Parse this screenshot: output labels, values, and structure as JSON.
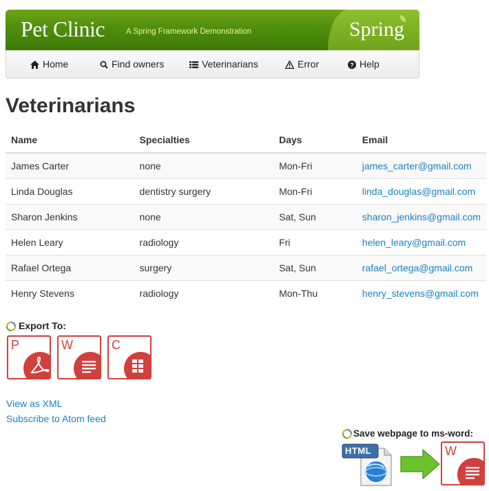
{
  "header": {
    "title": "Pet Clinic",
    "subtitle": "A Spring Framework Demonstration",
    "brand": "Spring"
  },
  "nav": [
    {
      "label": "Home",
      "icon": "home-icon"
    },
    {
      "label": "Find owners",
      "icon": "search-icon"
    },
    {
      "label": "Veterinarians",
      "icon": "list-icon"
    },
    {
      "label": "Error",
      "icon": "warning-icon"
    },
    {
      "label": "Help",
      "icon": "help-icon"
    }
  ],
  "page": {
    "title": "Veterinarians"
  },
  "table": {
    "headers": [
      "Name",
      "Specialties",
      "Days",
      "Email"
    ],
    "rows": [
      [
        "James Carter",
        "none",
        "Mon-Fri",
        "james_carter@gmail.com"
      ],
      [
        "Linda Douglas",
        "dentistry surgery",
        "Mon-Fri",
        "linda_douglas@gmail.com"
      ],
      [
        "Sharon Jenkins",
        "none",
        "Sat, Sun",
        "sharon_jenkins@gmail.com"
      ],
      [
        "Helen Leary",
        "radiology",
        "Fri",
        "helen_leary@gmail.com"
      ],
      [
        "Rafael Ortega",
        "surgery",
        "Sat, Sun",
        "rafael_ortega@gmail.com"
      ],
      [
        "Henry Stevens",
        "radiology",
        "Mon-Thu",
        "henry_stevens@gmail.com"
      ]
    ]
  },
  "export": {
    "label": "Export To:",
    "items": [
      {
        "letter": "P",
        "icon": "pdf-export-icon"
      },
      {
        "letter": "W",
        "icon": "word-export-icon"
      },
      {
        "letter": "C",
        "icon": "csv-export-icon"
      }
    ]
  },
  "links": {
    "xml": "View as XML",
    "atom": "Subscribe to Atom feed"
  },
  "save": {
    "label": "Save webpage to ms-word:",
    "html_badge": "HTML",
    "word_letter": "W"
  },
  "colors": {
    "banner_green": "#4f8e0c",
    "link_blue": "#1a80c0",
    "export_red": "#d0403d"
  }
}
